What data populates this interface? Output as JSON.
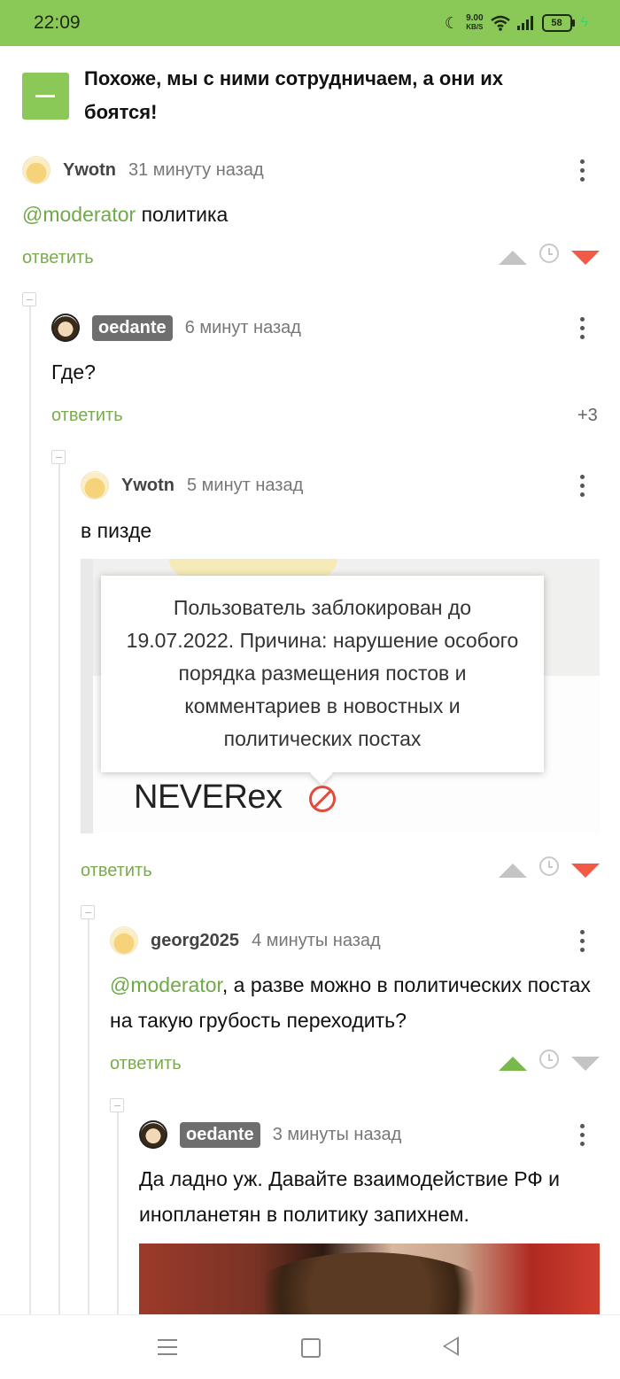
{
  "status_bar": {
    "time": "22:09",
    "net_speed_value": "9.00",
    "net_speed_unit": "KB/S",
    "battery": "58"
  },
  "post": {
    "title": "Похоже, мы с ними сотрудничаем, а они их боятся!"
  },
  "reply_label": "ответить",
  "comments": [
    {
      "author": "Ywotn",
      "time": "31 минуту назад",
      "mention": "@moderator",
      "text": " политика"
    },
    {
      "author": "oedante",
      "time": "6 минут назад",
      "text": "Где?",
      "score": "+3"
    },
    {
      "author": "Ywotn",
      "time": "5 минут назад",
      "text": "в пизде",
      "image": {
        "tooltip": "Пользователь заблокирован до 19.07.2022. Причина: нарушение особого порядка размещения постов и комментариев в новостных и политических постах",
        "nickname": "NEVERex"
      }
    },
    {
      "author": "georg2025",
      "time": "4 минуты назад",
      "mention": "@moderator",
      "text": ", а разве можно в политических постах на такую грубость переходить?"
    },
    {
      "author": "oedante",
      "time": "3 минуты назад",
      "text": "Да ладно уж. Давайте взаимодействие РФ и инопланетян в политику запихнем."
    }
  ],
  "colors": {
    "brand_green": "#8ac858",
    "downvote_red": "#f25a45",
    "mention_green": "#6fa94a"
  }
}
